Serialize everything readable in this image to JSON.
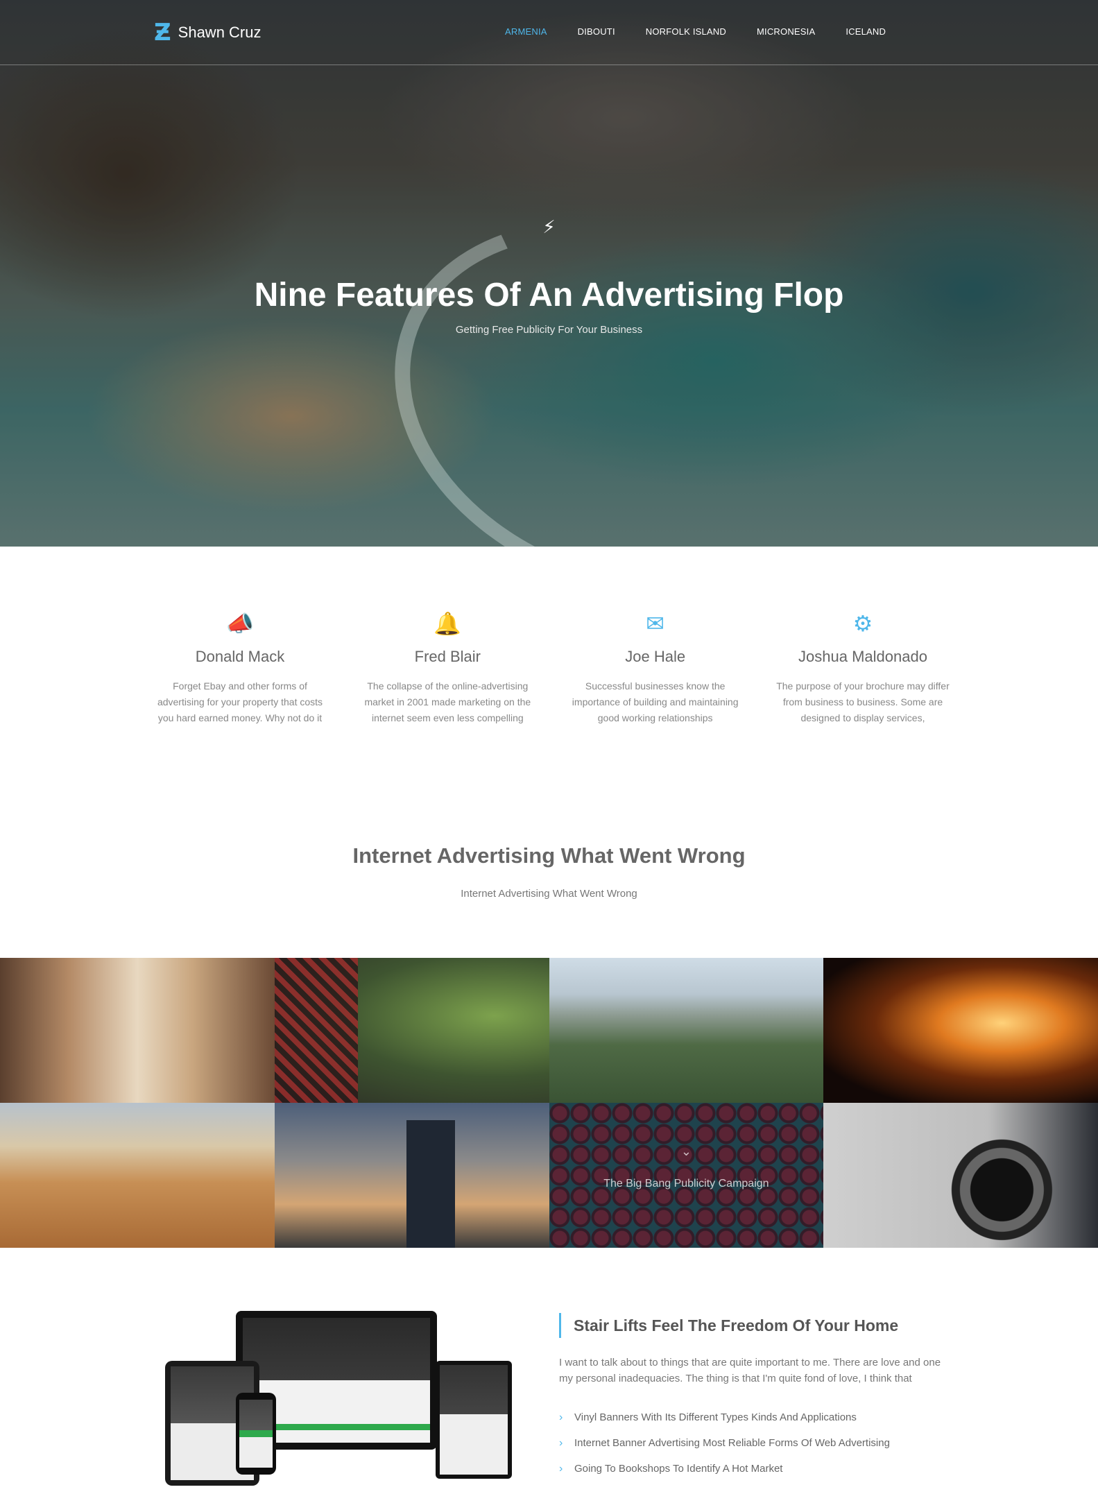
{
  "nav": {
    "logo_mark": "Ƶ",
    "logo_text": "Shawn Cruz",
    "items": [
      "ARMENIA",
      "DIBOUTI",
      "NORFOLK ISLAND",
      "MICRONESIA",
      "ICELAND"
    ]
  },
  "hero": {
    "icon": "⚡",
    "title": "Nine Features Of An Advertising Flop",
    "subtitle": "Getting Free Publicity For Your Business"
  },
  "features": [
    {
      "icon": "megaphone-icon",
      "glyph": "📣",
      "title": "Donald Mack",
      "text": "Forget Ebay and other forms of advertising for your property that costs you hard earned money. Why not do it"
    },
    {
      "icon": "bell-icon",
      "glyph": "🔔",
      "title": "Fred Blair",
      "text": "The collapse of the online-advertising market in 2001 made marketing on the internet seem even less compelling"
    },
    {
      "icon": "envelope-icon",
      "glyph": "✉",
      "title": "Joe Hale",
      "text": "Successful businesses know the importance of building and maintaining good working relationships"
    },
    {
      "icon": "gears-icon",
      "glyph": "⚙",
      "title": "Joshua Maldonado",
      "text": "The purpose of your brochure may differ from business to business. Some are designed to display services,"
    }
  ],
  "section": {
    "title": "Internet Advertising What Went Wrong",
    "subtitle": "Internet Advertising What Went Wrong"
  },
  "gallery": {
    "hover_caption": "The Big Bang Publicity Campaign",
    "hover_icon": "⌄"
  },
  "content": {
    "title": "Stair Lifts Feel The Freedom Of Your Home",
    "text": "I want to talk about to things that are quite important to me. There are love and one my personal inadequacies. The thing is that I'm quite fond of love, I think that",
    "list": [
      "Vinyl Banners With Its Different Types Kinds And Applications",
      "Internet Banner Advertising Most Reliable Forms Of Web Advertising",
      "Going To Bookshops To Identify A Hot Market"
    ]
  },
  "colors": {
    "accent": "#4fb7ea"
  }
}
